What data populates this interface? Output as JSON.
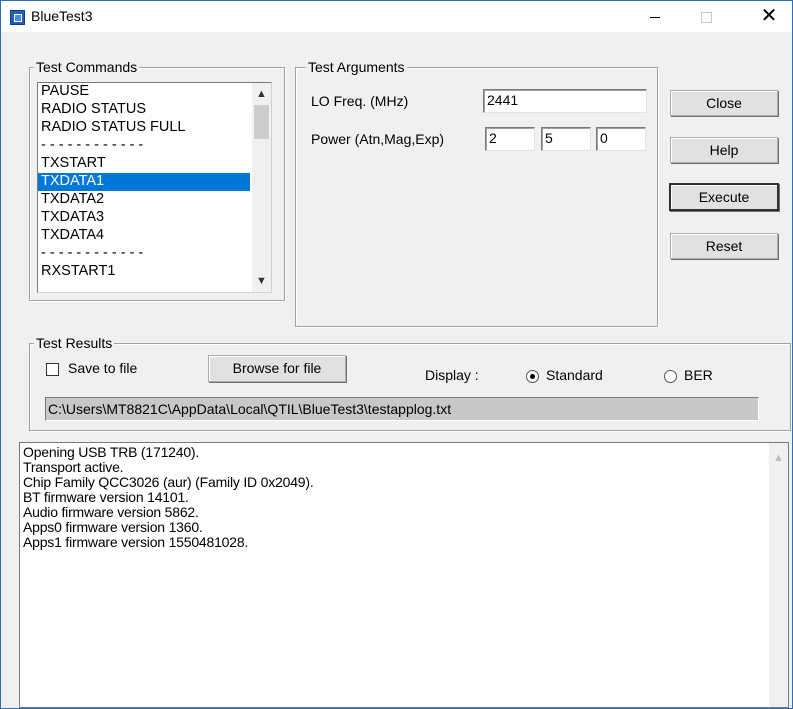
{
  "window": {
    "title": "BlueTest3",
    "minimize": "—",
    "maximize": "□",
    "close": "✕"
  },
  "commands": {
    "legend": "Test Commands",
    "items": [
      {
        "label": "PAUSE",
        "selected": false
      },
      {
        "label": "RADIO STATUS",
        "selected": false
      },
      {
        "label": "RADIO STATUS FULL",
        "selected": false
      },
      {
        "label": "- - - - - - - - - - - -",
        "selected": false
      },
      {
        "label": "TXSTART",
        "selected": false
      },
      {
        "label": "TXDATA1",
        "selected": true
      },
      {
        "label": "TXDATA2",
        "selected": false
      },
      {
        "label": "TXDATA3",
        "selected": false
      },
      {
        "label": "TXDATA4",
        "selected": false
      },
      {
        "label": "- - - - - - - - - - - -",
        "selected": false
      },
      {
        "label": "RXSTART1",
        "selected": false
      }
    ],
    "scroll_up": "▲",
    "scroll_down": "▼"
  },
  "arguments": {
    "legend": "Test Arguments",
    "lo_freq_label": "LO Freq. (MHz)",
    "lo_freq_value": "2441",
    "power_label": "Power (Atn,Mag,Exp)",
    "power_values": [
      "2",
      "5",
      "0"
    ]
  },
  "buttons": {
    "close": "Close",
    "help": "Help",
    "execute": "Execute",
    "reset": "Reset"
  },
  "results": {
    "legend": "Test Results",
    "save_to_file_label": "Save to file",
    "save_to_file_checked": false,
    "browse_label": "Browse for file",
    "display_label": "Display :",
    "standard_label": "Standard",
    "ber_label": "BER",
    "selected_display": "Standard",
    "log_path": "C:\\Users\\MT8821C\\AppData\\Local\\QTIL\\BlueTest3\\testapplog.txt"
  },
  "log": {
    "lines": [
      "Opening USB TRB (171240).",
      "Transport active.",
      "Chip Family QCC3026 (aur) (Family ID 0x2049).",
      "BT firmware version 14101.",
      "Audio firmware version 5862.",
      "Apps0 firmware version 1360.",
      "Apps1 firmware version 1550481028."
    ],
    "scroll_up": "▲"
  },
  "colors": {
    "selection": "#0078d7",
    "window_border": "#2b6fb6",
    "dialog_bg": "#f0f0f0"
  }
}
